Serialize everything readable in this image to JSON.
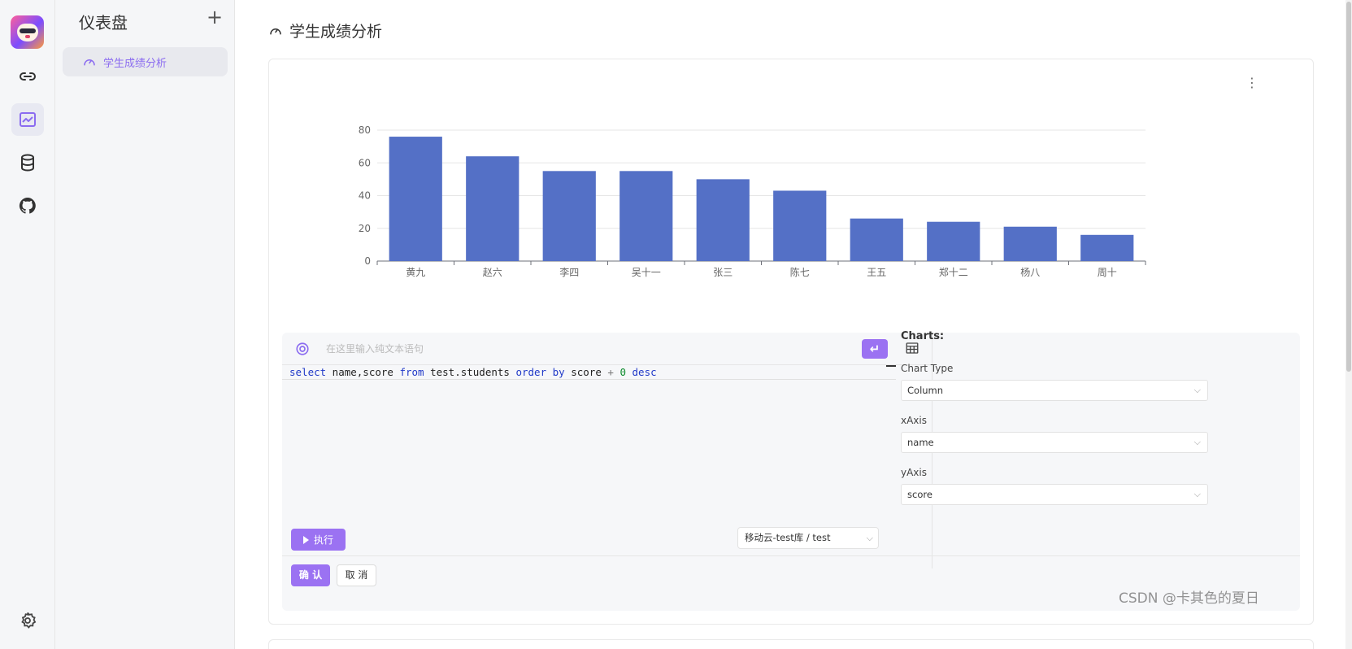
{
  "sidebar": {
    "rail": {
      "items": [
        {
          "icon": "link-icon"
        },
        {
          "icon": "chart-icon"
        },
        {
          "icon": "database-icon"
        },
        {
          "icon": "github-icon"
        }
      ],
      "settings_icon": "gear-icon"
    },
    "title": "仪表盘",
    "add_label": "+",
    "items": [
      {
        "label": "学生成绩分析",
        "icon": "dashboard-icon"
      }
    ]
  },
  "main": {
    "title": "学生成绩分析",
    "card_menu": "⋮"
  },
  "chart_data": {
    "type": "bar",
    "categories": [
      "黄九",
      "赵六",
      "李四",
      "吴十一",
      "张三",
      "陈七",
      "王五",
      "郑十二",
      "杨八",
      "周十"
    ],
    "values": [
      76,
      64,
      55,
      55,
      50,
      43,
      26,
      24,
      21,
      16
    ],
    "ylim": [
      0,
      80
    ],
    "yticks": [
      0,
      20,
      40,
      60,
      80
    ],
    "grid": true,
    "color": "#5470c6"
  },
  "editor": {
    "nl_placeholder": "在这里输入纯文本语句",
    "enter_icon": "↵",
    "table_icon": "table-icon",
    "sql": {
      "select": "select",
      "cols": " name,score ",
      "from": "from",
      "table": " test.students ",
      "order": "order",
      "by": "by",
      "field": " score ",
      "plus": "+",
      "zero": "0",
      "desc": "desc"
    },
    "execute_label": "执行",
    "datasource": "移动云-test库 / test",
    "confirm_label": "确 认",
    "cancel_label": "取 消"
  },
  "charts_config": {
    "heading": "Charts:",
    "chart_type_label": "Chart Type",
    "chart_type_value": "Column",
    "xaxis_label": "xAxis",
    "xaxis_value": "name",
    "yaxis_label": "yAxis",
    "yaxis_value": "score"
  },
  "watermark": "CSDN @卡其色的夏日",
  "colors": {
    "accent": "#9b72f2",
    "bar": "#5470c6",
    "nav_active_text": "#8b6cf0"
  }
}
